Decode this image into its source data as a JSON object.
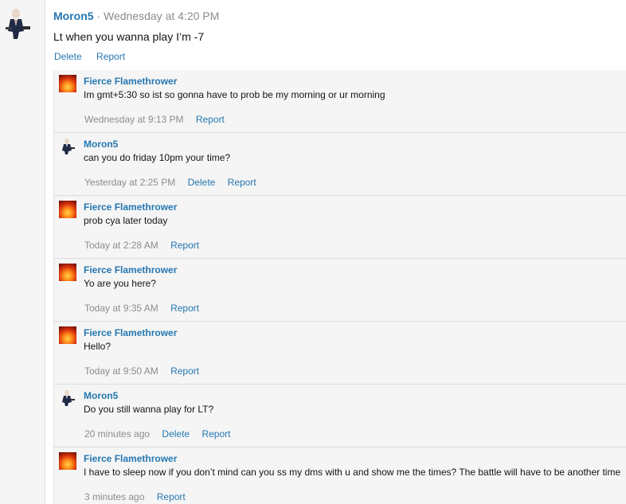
{
  "post": {
    "author": "Moron5",
    "meta": "· Wednesday at 4:20 PM",
    "text": "Lt when you wanna play I’m -7",
    "actions": {
      "delete": "Delete",
      "report": "Report"
    }
  },
  "comments": [
    {
      "author": "Fierce Flamethrower",
      "avatar": "flame-avatar",
      "text": "Im gmt+5:30 so ist so gonna have to prob be my morning or ur morning",
      "time": "Wednesday at 9:13 PM",
      "delete": "",
      "report": "Report"
    },
    {
      "author": "Moron5",
      "avatar": "moron-avatar",
      "text": "can you do friday 10pm your time?",
      "time": "Yesterday at 2:25 PM",
      "delete": "Delete",
      "report": "Report"
    },
    {
      "author": "Fierce Flamethrower",
      "avatar": "flame-avatar",
      "text": "prob cya later today",
      "time": "Today at 2:28 AM",
      "delete": "",
      "report": "Report"
    },
    {
      "author": "Fierce Flamethrower",
      "avatar": "flame-avatar",
      "text": "Yo are you here?",
      "time": "Today at 9:35 AM",
      "delete": "",
      "report": "Report"
    },
    {
      "author": "Fierce Flamethrower",
      "avatar": "flame-avatar",
      "text": "Hello?",
      "time": "Today at 9:50 AM",
      "delete": "",
      "report": "Report"
    },
    {
      "author": "Moron5",
      "avatar": "moron-avatar",
      "text": "Do you still wanna play for LT?",
      "time": "20 minutes ago",
      "delete": "Delete",
      "report": "Report"
    },
    {
      "author": "Fierce Flamethrower",
      "avatar": "flame-avatar",
      "text": "I have to sleep now if you don’t mind can you ss my dms with u and show me the times? The battle will have to be another time",
      "time": "3 minutes ago",
      "delete": "",
      "report": "Report"
    }
  ]
}
